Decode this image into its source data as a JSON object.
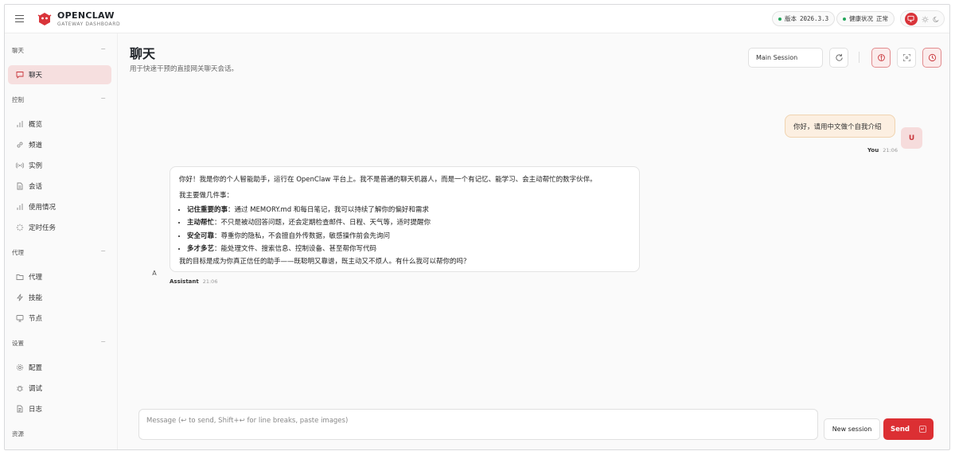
{
  "brand": {
    "name": "OPENCLAW",
    "subtitle": "GATEWAY DASHBOARD"
  },
  "status": {
    "version_label": "版本",
    "version": "2026.3.3",
    "health_label": "健康状况",
    "health_value": "正常",
    "health_color": "#22a55a"
  },
  "sidebar": {
    "groups": [
      {
        "title": "聊天",
        "items": [
          {
            "label": "聊天",
            "icon": "message-icon",
            "active": true
          }
        ]
      },
      {
        "title": "控制",
        "items": [
          {
            "label": "概览",
            "icon": "bar-chart-icon"
          },
          {
            "label": "频道",
            "icon": "link-icon"
          },
          {
            "label": "实例",
            "icon": "radio-icon"
          },
          {
            "label": "会话",
            "icon": "document-icon"
          },
          {
            "label": "使用情况",
            "icon": "bar-chart-icon"
          },
          {
            "label": "定时任务",
            "icon": "loader-icon"
          }
        ]
      },
      {
        "title": "代理",
        "items": [
          {
            "label": "代理",
            "icon": "folder-icon"
          },
          {
            "label": "技能",
            "icon": "zap-icon"
          },
          {
            "label": "节点",
            "icon": "monitor-icon"
          }
        ]
      },
      {
        "title": "设置",
        "items": [
          {
            "label": "配置",
            "icon": "gear-icon"
          },
          {
            "label": "调试",
            "icon": "bug-icon"
          },
          {
            "label": "日志",
            "icon": "file-text-icon"
          }
        ]
      },
      {
        "title": "资源",
        "items": []
      }
    ]
  },
  "page": {
    "title": "聊天",
    "subtitle": "用于快速干预的直接网关聊天会话。",
    "session_select": "Main Session"
  },
  "chat": {
    "user_message": {
      "text": "你好，请用中文做个自我介绍",
      "sender": "You",
      "time": "21:06",
      "avatar": "U"
    },
    "assistant_message": {
      "intro": "你好！我是你的个人智能助手，运行在 OpenClaw 平台上。我不是普通的聊天机器人，而是一个有记忆、能学习、会主动帮忙的数字伙伴。",
      "list_heading": "我主要做几件事：",
      "bullets": [
        {
          "bold": "记住重要的事",
          "text": "：通过 MEMORY.md 和每日笔记，我可以持续了解你的偏好和需求"
        },
        {
          "bold": "主动帮忙",
          "text": "：不只是被动回答问题，还会定期检查邮件、日程、天气等，适时提醒你"
        },
        {
          "bold": "安全可靠",
          "text": "：尊重你的隐私，不会擅自外传数据，敏感操作前会先询问"
        },
        {
          "bold": "多才多艺",
          "text": "：能处理文件、搜索信息、控制设备、甚至帮你写代码"
        }
      ],
      "closing": "我的目标是成为你真正信任的助手——既聪明又靠谱，既主动又不烦人。有什么我可以帮你的吗？",
      "sender": "Assistant",
      "time": "21:06",
      "avatar": "A"
    }
  },
  "composer": {
    "placeholder": "Message (↩ to send, Shift+↩ for line breaks, paste images)",
    "new_session": "New session",
    "send": "Send",
    "send_kbd": "↵"
  },
  "colors": {
    "accent": "#dc2f33",
    "active_bg": "#f6dfdf",
    "user_bubble": "#fcefe1"
  }
}
